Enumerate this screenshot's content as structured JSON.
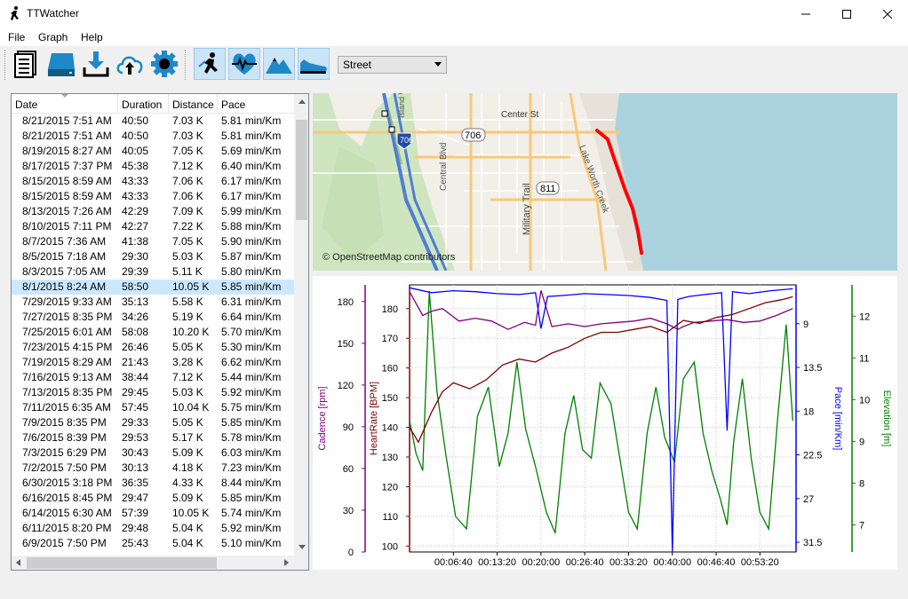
{
  "window": {
    "title": "TTWatcher"
  },
  "menu": {
    "file": "File",
    "graph": "Graph",
    "help": "Help"
  },
  "toolbar": {
    "icons": [
      "list-icon",
      "drive-icon",
      "download-icon",
      "cloud-upload-icon",
      "gear-icon",
      "runner-icon",
      "heart-icon",
      "mountain-icon",
      "shoe-icon"
    ],
    "map_style": "Street"
  },
  "table": {
    "headers": [
      "Date",
      "Duration",
      "Distance",
      "Pace"
    ],
    "rows": [
      [
        "8/21/2015 7:51 AM",
        "40:50",
        "7.03 K",
        "5.81 min/Km"
      ],
      [
        "8/21/2015 7:51 AM",
        "40:50",
        "7.03 K",
        "5.81 min/Km"
      ],
      [
        "8/19/2015 8:27 AM",
        "40:05",
        "7.05 K",
        "5.69 min/Km"
      ],
      [
        "8/17/2015 7:37 PM",
        "45:38",
        "7.12 K",
        "6.40 min/Km"
      ],
      [
        "8/15/2015 8:59 AM",
        "43:33",
        "7.06 K",
        "6.17 min/Km"
      ],
      [
        "8/15/2015 8:59 AM",
        "43:33",
        "7.06 K",
        "6.17 min/Km"
      ],
      [
        "8/13/2015 7:26 AM",
        "42:29",
        "7.09 K",
        "5.99 min/Km"
      ],
      [
        "8/10/2015 7:11 PM",
        "42:27",
        "7.22 K",
        "5.88 min/Km"
      ],
      [
        "8/7/2015 7:36 AM",
        "41:38",
        "7.05 K",
        "5.90 min/Km"
      ],
      [
        "8/5/2015 7:18 AM",
        "29:30",
        "5.03 K",
        "5.87 min/Km"
      ],
      [
        "8/3/2015 7:05 AM",
        "29:39",
        "5.11 K",
        "5.80 min/Km"
      ],
      [
        "8/1/2015 8:24 AM",
        "58:50",
        "10.05 K",
        "5.85 min/Km"
      ],
      [
        "7/29/2015 9:33 AM",
        "35:13",
        "5.58 K",
        "6.31 min/Km"
      ],
      [
        "7/27/2015 8:35 PM",
        "34:26",
        "5.19 K",
        "6.64 min/Km"
      ],
      [
        "7/25/2015 6:01 AM",
        "58:08",
        "10.20 K",
        "5.70 min/Km"
      ],
      [
        "7/23/2015 4:15 PM",
        "26:46",
        "5.05 K",
        "5.30 min/Km"
      ],
      [
        "7/19/2015 8:29 AM",
        "21:43",
        "3.28 K",
        "6.62 min/Km"
      ],
      [
        "7/16/2015 9:13 AM",
        "38:44",
        "7.12 K",
        "5.44 min/Km"
      ],
      [
        "7/13/2015 8:35 PM",
        "29:45",
        "5.03 K",
        "5.92 min/Km"
      ],
      [
        "7/11/2015 6:35 AM",
        "57:45",
        "10.04 K",
        "5.75 min/Km"
      ],
      [
        "7/9/2015 8:35 PM",
        "29:33",
        "5.05 K",
        "5.85 min/Km"
      ],
      [
        "7/6/2015 8:39 PM",
        "29:53",
        "5.17 K",
        "5.78 min/Km"
      ],
      [
        "7/3/2015 6:29 PM",
        "30:43",
        "5.09 K",
        "6.03 min/Km"
      ],
      [
        "7/2/2015 7:50 PM",
        "30:13",
        "4.18 K",
        "7.23 min/Km"
      ],
      [
        "6/30/2015 3:18 PM",
        "36:35",
        "4.33 K",
        "8.44 min/Km"
      ],
      [
        "6/16/2015 8:45 PM",
        "29:47",
        "5.09 K",
        "5.85 min/Km"
      ],
      [
        "6/14/2015 6:30 AM",
        "57:39",
        "10.05 K",
        "5.74 min/Km"
      ],
      [
        "6/11/2015 8:20 PM",
        "29:48",
        "5.04 K",
        "5.92 min/Km"
      ],
      [
        "6/9/2015 7:50 PM",
        "25:43",
        "5.04 K",
        "5.10 min/Km"
      ]
    ],
    "selected_index": 11
  },
  "map": {
    "attribution": "© OpenStreetMap contributors",
    "labels": [
      "Center St",
      "706",
      "95",
      "811",
      "Central Blvd",
      "Military Trail",
      "Lake Worth Creek",
      "Island Wa"
    ]
  },
  "chart_data": {
    "type": "line",
    "x_tick_labels": [
      "00:06:40",
      "00:13:20",
      "00:20:00",
      "00:26:40",
      "00:33:20",
      "00:40:00",
      "00:46:40",
      "00:53:20"
    ],
    "x_tick_seconds": [
      400,
      800,
      1200,
      1600,
      2000,
      2400,
      2800,
      3200
    ],
    "xlim": [
      0,
      3530
    ],
    "axes": [
      {
        "label": "Cadence [rpm]",
        "color": "#800080",
        "ticks": [
          "0",
          "30",
          "60",
          "90",
          "120",
          "150",
          "180"
        ],
        "ylim": [
          0,
          192
        ]
      },
      {
        "label": "HeartRate [BPM]",
        "color": "#800000",
        "ticks": [
          "100",
          "110",
          "120",
          "130",
          "140",
          "150",
          "160",
          "170",
          "180"
        ],
        "ylim": [
          98,
          188
        ]
      },
      {
        "label": "Pace [min/Km]",
        "color": "#0000ff",
        "ticks": [
          "9",
          "13.5",
          "18",
          "22.5",
          "27",
          "31.5"
        ],
        "ylim": [
          5,
          32.5
        ],
        "inverted": true
      },
      {
        "label": "Elevation [m]",
        "color": "#008000",
        "ticks": [
          "7",
          "8",
          "9",
          "10",
          "11",
          "12"
        ],
        "ylim": [
          6.35,
          12.75
        ]
      }
    ],
    "grid": true,
    "series": [
      {
        "axis": 0,
        "color": "#800080",
        "x": [
          0,
          120,
          200,
          300,
          450,
          600,
          750,
          900,
          1050,
          1150,
          1200,
          1300,
          1450,
          1600,
          1750,
          1900,
          2050,
          2200,
          2350,
          2450,
          2500,
          2600,
          2750,
          2900,
          3050,
          3200,
          3350,
          3500
        ],
        "y": [
          187,
          170,
          173,
          175,
          166,
          168,
          166,
          160,
          165,
          163,
          188,
          162,
          164,
          162,
          164,
          165,
          166,
          168,
          164,
          160,
          162,
          165,
          166,
          167,
          165,
          166,
          170,
          175
        ]
      },
      {
        "axis": 1,
        "color": "#800000",
        "x": [
          0,
          80,
          200,
          300,
          400,
          550,
          700,
          850,
          1000,
          1150,
          1300,
          1450,
          1600,
          1750,
          1900,
          2050,
          2200,
          2350,
          2500,
          2650,
          2800,
          2950,
          3100,
          3250,
          3400,
          3500
        ],
        "y": [
          140,
          135,
          145,
          152,
          155,
          153,
          156,
          161,
          163,
          162,
          165,
          167,
          170,
          172,
          172,
          173,
          174,
          172,
          176,
          175,
          177,
          178,
          180,
          182,
          183,
          184
        ]
      },
      {
        "axis": 2,
        "color": "#0000ff",
        "x": [
          0,
          200,
          400,
          600,
          800,
          1000,
          1150,
          1200,
          1260,
          1400,
          1600,
          1800,
          2000,
          2200,
          2350,
          2400,
          2450,
          2550,
          2700,
          2850,
          2900,
          2950,
          3100,
          3300,
          3500
        ],
        "y": [
          5.3,
          5.8,
          5.6,
          5.7,
          5.9,
          6.0,
          5.8,
          9.5,
          6.2,
          6.1,
          5.9,
          6.0,
          6.1,
          6.3,
          6.6,
          32.5,
          6.5,
          6.2,
          6.0,
          5.8,
          20,
          5.7,
          5.9,
          5.6,
          5.4
        ]
      },
      {
        "axis": 3,
        "color": "#008000",
        "x": [
          0,
          60,
          120,
          180,
          250,
          330,
          420,
          520,
          620,
          720,
          820,
          900,
          980,
          1060,
          1150,
          1250,
          1330,
          1420,
          1500,
          1580,
          1660,
          1740,
          1840,
          1920,
          2000,
          2080,
          2170,
          2250,
          2330,
          2420,
          2500,
          2600,
          2680,
          2760,
          2840,
          2900,
          2960,
          3040,
          3120,
          3200,
          3280,
          3360,
          3440,
          3500
        ],
        "y": [
          9.5,
          8.7,
          8.3,
          12.6,
          10.2,
          8.7,
          7.2,
          6.9,
          9.6,
          10.3,
          8.4,
          9.2,
          10.9,
          9.3,
          8.4,
          7.3,
          6.8,
          9.2,
          10.1,
          8.8,
          8.6,
          10.4,
          9.9,
          8.6,
          7.3,
          6.9,
          9.2,
          10.3,
          9.1,
          8.5,
          10.5,
          10.9,
          9.2,
          8.3,
          7.6,
          7.0,
          9.0,
          10.5,
          8.6,
          7.3,
          6.9,
          9.5,
          11.8,
          9.5
        ]
      }
    ]
  }
}
